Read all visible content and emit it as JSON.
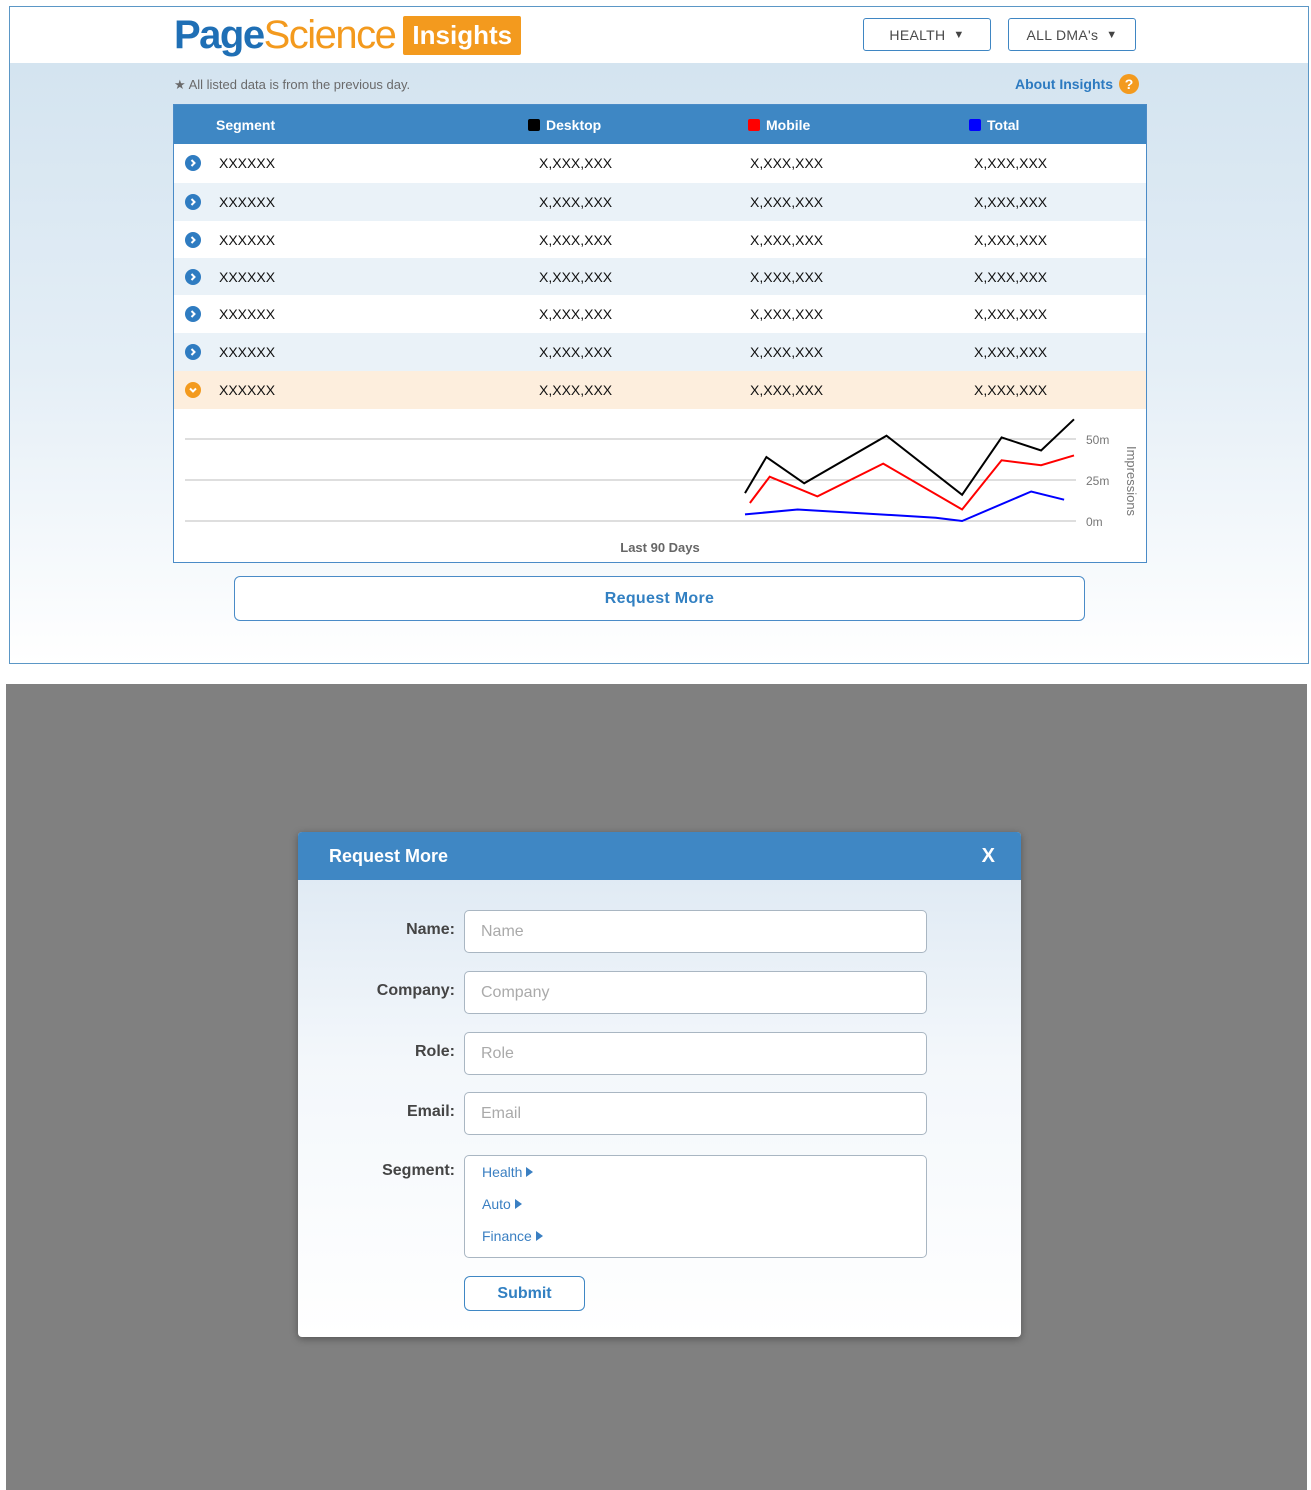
{
  "header": {
    "logo_part1": "Page",
    "logo_part2": "Science",
    "logo_badge": "Insights",
    "category_select": "HEALTH",
    "dma_select": "ALL DMA's"
  },
  "note": "All listed data is from the previous day.",
  "about_link": "About Insights",
  "help_glyph": "?",
  "table": {
    "columns": [
      {
        "label": "Segment"
      },
      {
        "label": "Desktop",
        "color": "#000000"
      },
      {
        "label": "Mobile",
        "color": "#ff0000"
      },
      {
        "label": "Total",
        "color": "#0000ff"
      }
    ],
    "rows": [
      {
        "segment": "XXXXXX",
        "desktop": "X,XXX,XXX",
        "mobile": "X,XXX,XXX",
        "total": "X,XXX,XXX",
        "expanded": false
      },
      {
        "segment": "XXXXXX",
        "desktop": "X,XXX,XXX",
        "mobile": "X,XXX,XXX",
        "total": "X,XXX,XXX",
        "expanded": false
      },
      {
        "segment": "XXXXXX",
        "desktop": "X,XXX,XXX",
        "mobile": "X,XXX,XXX",
        "total": "X,XXX,XXX",
        "expanded": false
      },
      {
        "segment": "XXXXXX",
        "desktop": "X,XXX,XXX",
        "mobile": "X,XXX,XXX",
        "total": "X,XXX,XXX",
        "expanded": false
      },
      {
        "segment": "XXXXXX",
        "desktop": "X,XXX,XXX",
        "mobile": "X,XXX,XXX",
        "total": "X,XXX,XXX",
        "expanded": false
      },
      {
        "segment": "XXXXXX",
        "desktop": "X,XXX,XXX",
        "mobile": "X,XXX,XXX",
        "total": "X,XXX,XXX",
        "expanded": false
      },
      {
        "segment": "XXXXXX",
        "desktop": "X,XXX,XXX",
        "mobile": "X,XXX,XXX",
        "total": "X,XXX,XXX",
        "expanded": true
      }
    ]
  },
  "chart_data": {
    "type": "line",
    "xlabel": "Last 90 Days",
    "ylabel": "Impressions",
    "yticks": [
      "0m",
      "25m",
      "50m"
    ],
    "ylim": [
      0,
      60
    ],
    "xlim": [
      0,
      100
    ],
    "grid": true,
    "series": [
      {
        "color": "#000000",
        "x": [
          0,
          6.5,
          18,
          43,
          66,
          78,
          90,
          100
        ],
        "y": [
          17,
          39,
          23,
          52,
          16,
          51,
          43,
          62
        ]
      },
      {
        "color": "#ff0000",
        "x": [
          1.5,
          7.5,
          22,
          42,
          66,
          78,
          90,
          100
        ],
        "y": [
          11,
          27,
          15,
          35,
          7,
          37,
          34,
          40
        ]
      },
      {
        "color": "#0000ff",
        "x": [
          0,
          16,
          58,
          66,
          87,
          97
        ],
        "y": [
          4,
          7,
          2,
          0,
          18,
          13
        ]
      }
    ]
  },
  "request_button": "Request More",
  "modal": {
    "title": "Request More",
    "close": "X",
    "fields": [
      {
        "label": "Name:",
        "placeholder": "Name",
        "value": ""
      },
      {
        "label": "Company:",
        "placeholder": "Company",
        "value": ""
      },
      {
        "label": "Role:",
        "placeholder": "Role",
        "value": ""
      },
      {
        "label": "Email:",
        "placeholder": "Email",
        "value": ""
      }
    ],
    "segment_label": "Segment:",
    "segments": [
      "Health",
      "Auto",
      "Finance"
    ],
    "submit": "Submit"
  }
}
